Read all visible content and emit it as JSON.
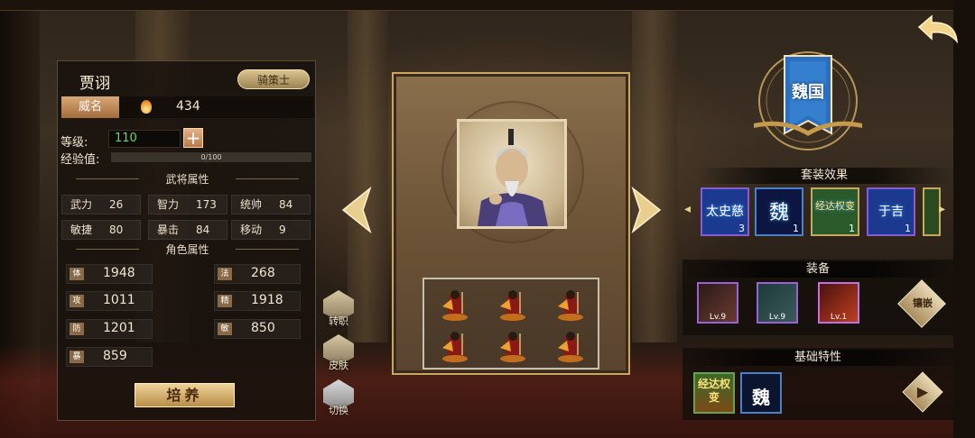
{
  "hero": {
    "name": "贾诩",
    "class_label": "骑策士",
    "prestige_label": "威名",
    "prestige_value": "434",
    "level_label": "等级:",
    "level_value": "110",
    "exp_label": "经验值:",
    "exp_value": "0/100",
    "exp_progress": 0
  },
  "general_attrs": {
    "title": "武将属性",
    "items": [
      {
        "k": "武力",
        "v": "26"
      },
      {
        "k": "智力",
        "v": "173"
      },
      {
        "k": "统帅",
        "v": "84"
      },
      {
        "k": "敏捷",
        "v": "80"
      },
      {
        "k": "暴击",
        "v": "84"
      },
      {
        "k": "移动",
        "v": "9"
      }
    ]
  },
  "role_attrs": {
    "title": "角色属性",
    "items": [
      {
        "tag": "体",
        "v": "1948"
      },
      {
        "tag": "法",
        "v": "268"
      },
      {
        "tag": "攻",
        "v": "1011"
      },
      {
        "tag": "精",
        "v": "1918"
      },
      {
        "tag": "防",
        "v": "1201"
      },
      {
        "tag": "敏",
        "v": "850"
      },
      {
        "tag": "暴",
        "v": "859"
      }
    ]
  },
  "train_label": "培养",
  "side_actions": [
    {
      "label": "转职",
      "icon": "promote-icon"
    },
    {
      "label": "皮肤",
      "icon": "skin-icon"
    },
    {
      "label": "切换",
      "icon": "switch-icon"
    }
  ],
  "faction": {
    "label": "魏国",
    "color": "#2a6fc0"
  },
  "set_effect": {
    "title": "套装效果",
    "items": [
      {
        "name": "太史慈",
        "count": "3",
        "color": "#1b3a8f"
      },
      {
        "name": "魏",
        "count": "1",
        "color": "#0c1640"
      },
      {
        "name": "经达权变",
        "count": "1",
        "color": "#2a5a2a"
      },
      {
        "name": "于吉",
        "count": "1",
        "color": "#1b3a8f"
      }
    ]
  },
  "equipment": {
    "title": "装备",
    "items": [
      {
        "level": "Lv.9",
        "icon": "sword-icon"
      },
      {
        "level": "Lv.9",
        "icon": "armor-icon"
      },
      {
        "level": "Lv.1",
        "icon": "charm-icon"
      }
    ],
    "inlay_label": "镶嵌"
  },
  "base_traits": {
    "title": "基础特性",
    "items": [
      {
        "name": "经达权变",
        "icon": "trait-strategy-icon"
      },
      {
        "name": "魏",
        "icon": "trait-wei-icon"
      }
    ]
  }
}
